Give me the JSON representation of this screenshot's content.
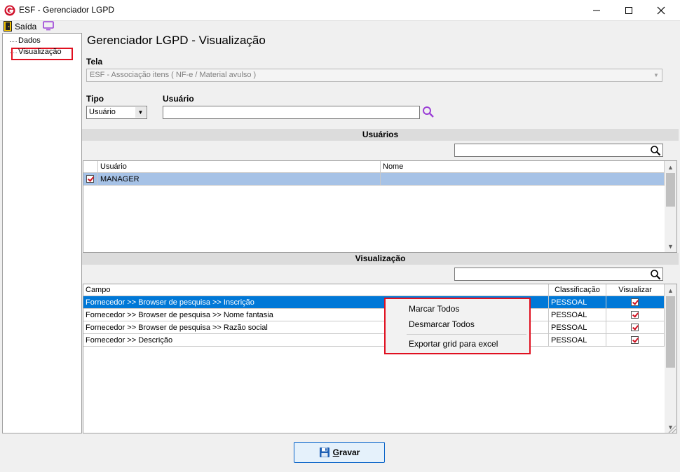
{
  "window": {
    "title": "ESF - Gerenciador LGPD",
    "icon": "app-logo-icon"
  },
  "menubar": {
    "exit_label": "Saída"
  },
  "tree": {
    "items": [
      {
        "label": "Dados"
      },
      {
        "label": "Visualização",
        "selected": true
      }
    ]
  },
  "page": {
    "title": "Gerenciador LGPD - Visualização"
  },
  "form": {
    "tela_label": "Tela",
    "tela_value": "ESF - Associação itens ( NF-e / Material avulso )",
    "tipo_label": "Tipo",
    "tipo_value": "Usuário",
    "usuario_label": "Usuário",
    "usuario_value": ""
  },
  "usuarios_section": {
    "header": "Usuários",
    "search_value": "",
    "columns": [
      "Usuário",
      "Nome"
    ],
    "rows": [
      {
        "checked": true,
        "usuario": "MANAGER",
        "nome": ""
      }
    ]
  },
  "visualizacao_section": {
    "header": "Visualização",
    "search_value": "",
    "columns": [
      "Campo",
      "Classificação",
      "Visualizar"
    ],
    "rows": [
      {
        "campo": "Fornecedor >> Browser de pesquisa >> Inscrição",
        "classificacao": "PESSOAL",
        "visualizar": true
      },
      {
        "campo": "Fornecedor >> Browser de pesquisa >> Nome fantasia",
        "classificacao": "PESSOAL",
        "visualizar": true
      },
      {
        "campo": "Fornecedor >> Browser de pesquisa >> Razão social",
        "classificacao": "PESSOAL",
        "visualizar": true
      },
      {
        "campo": "Fornecedor >> Descrição",
        "classificacao": "PESSOAL",
        "visualizar": true
      }
    ]
  },
  "context_menu": {
    "items": [
      "Marcar Todos",
      "Desmarcar Todos",
      "Exportar grid para excel"
    ]
  },
  "footer": {
    "save_label_first": "G",
    "save_label_rest": "ravar"
  },
  "colors": {
    "selection": "#0078d7",
    "row_selected_grey": "#a6c2e6",
    "highlight_border": "#e01020",
    "accent_lookup": "#9b3fd6"
  }
}
